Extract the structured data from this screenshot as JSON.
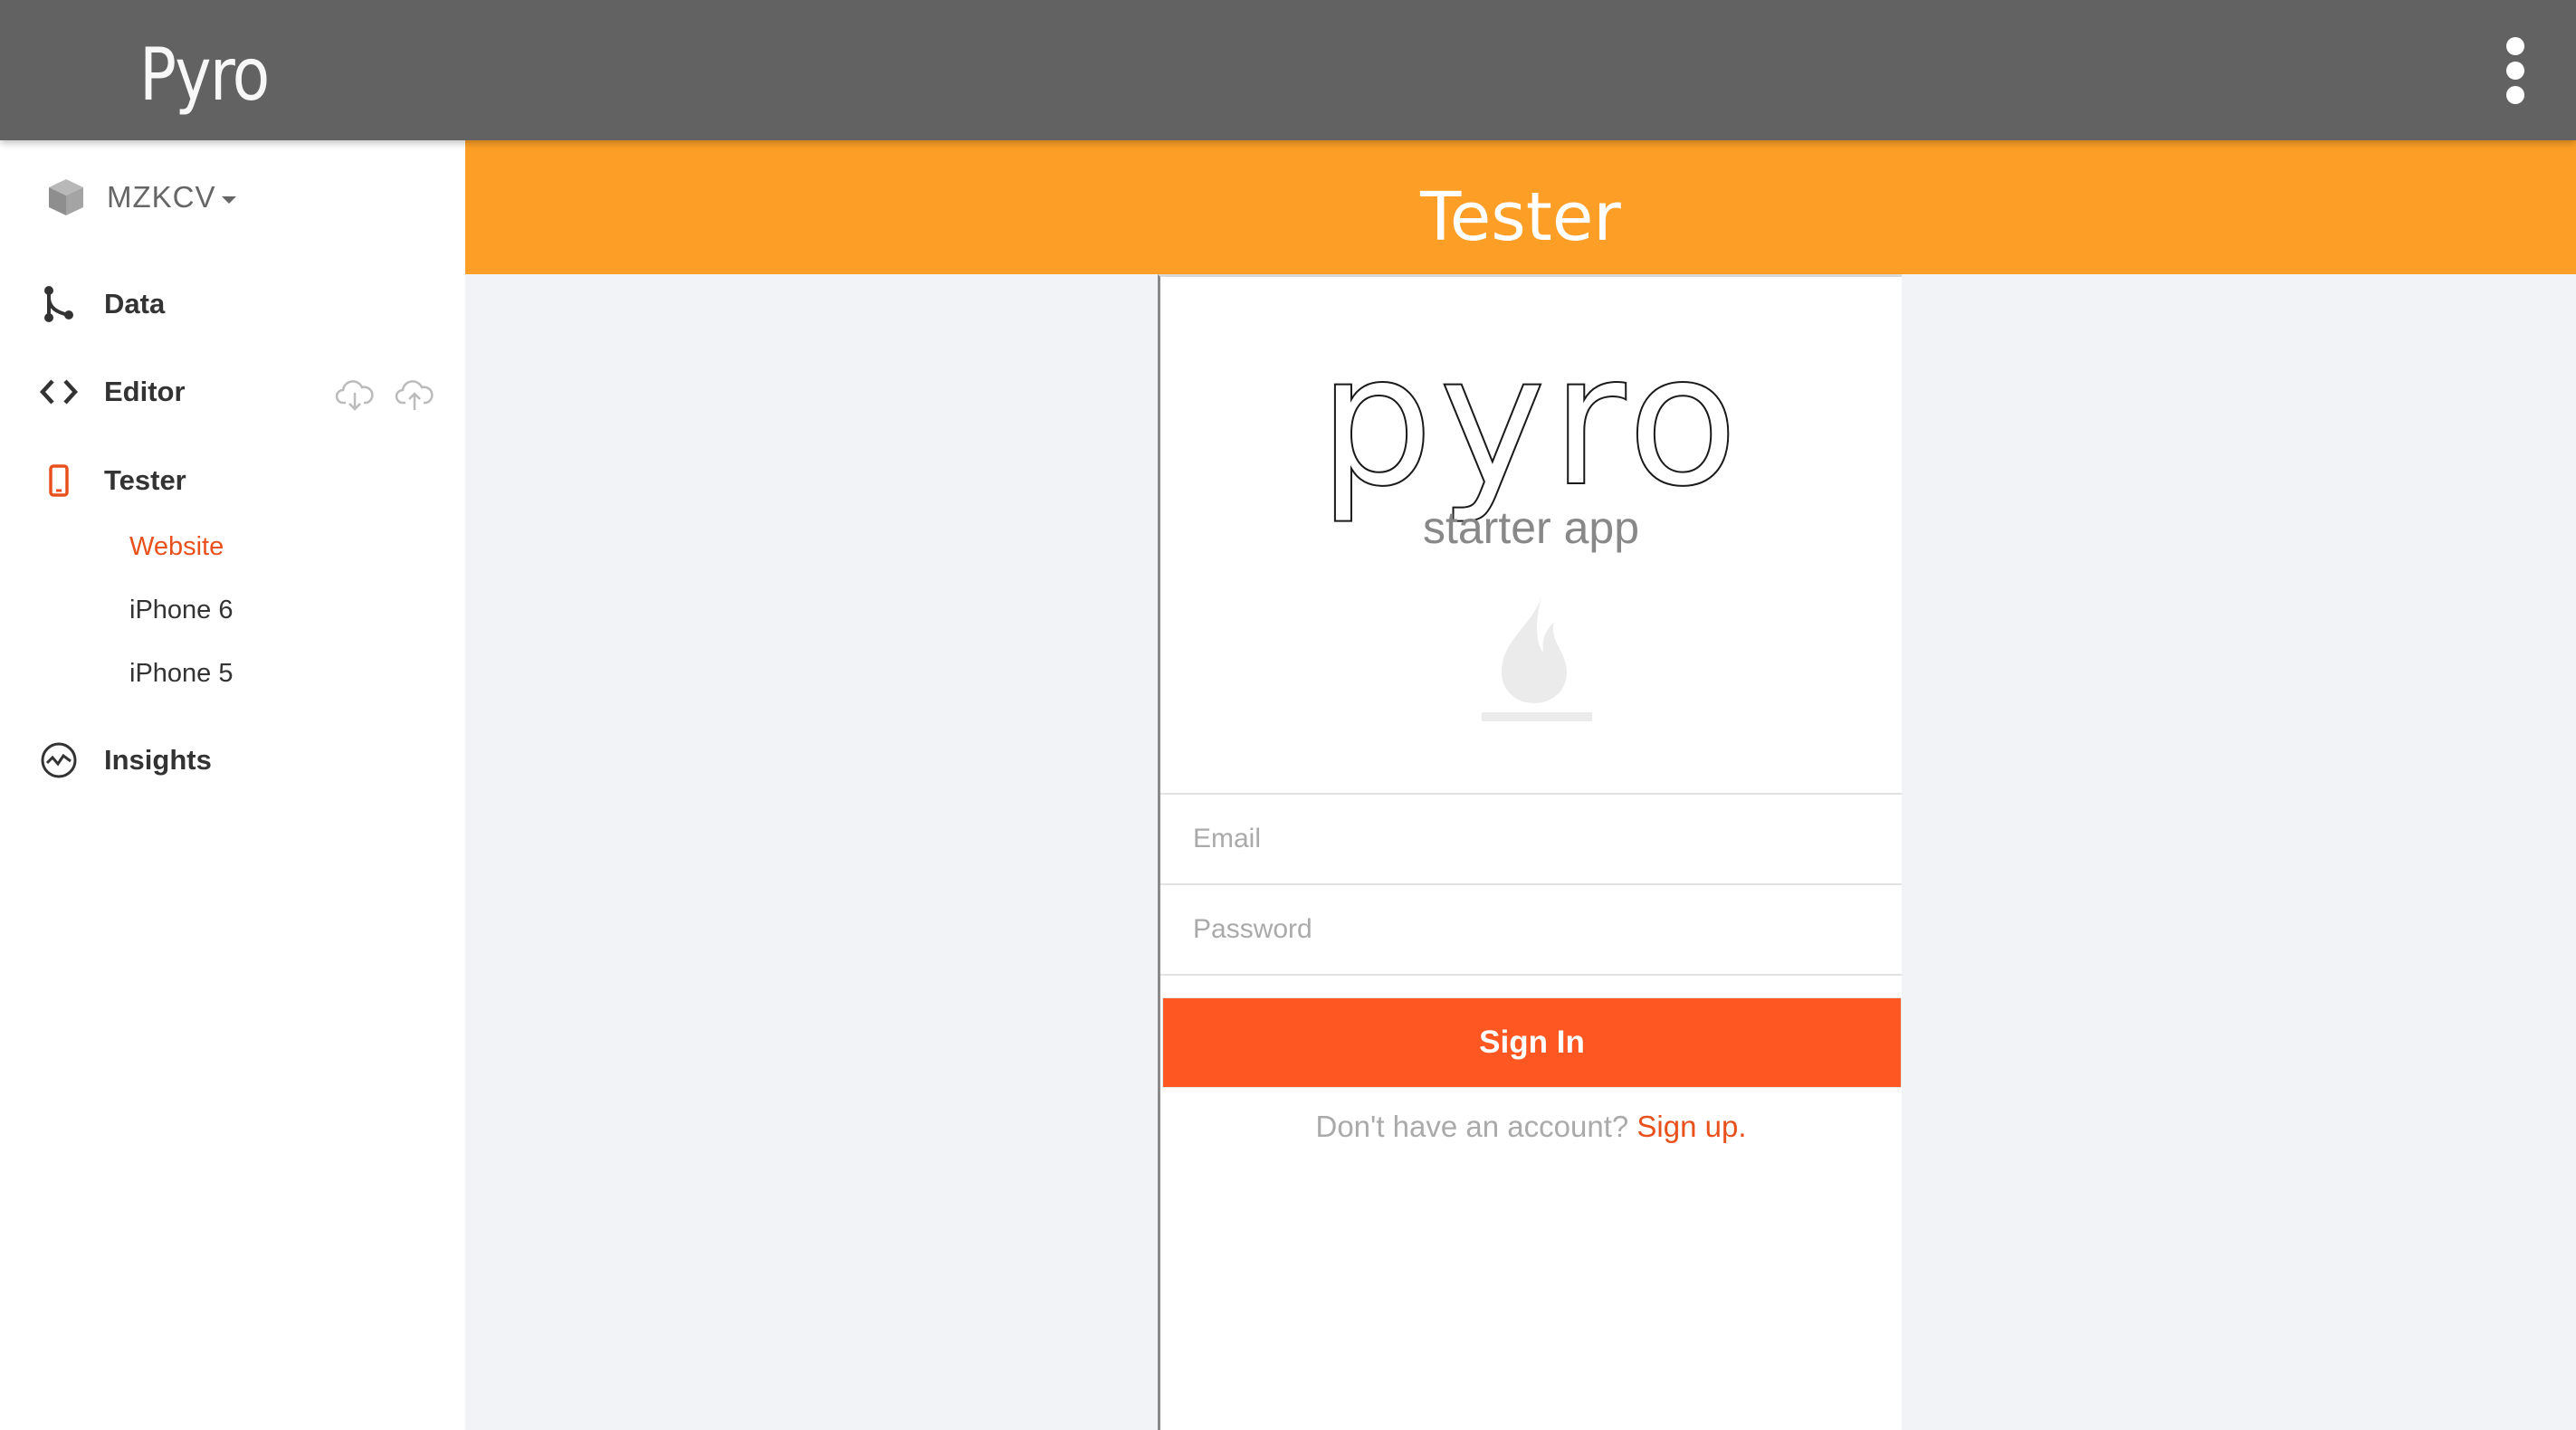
{
  "app": {
    "brand": "Pyro"
  },
  "project": {
    "name": "MZKCV"
  },
  "sidebar": {
    "items": [
      {
        "label": "Data",
        "icon": "branch-icon"
      },
      {
        "label": "Editor",
        "icon": "code-icon"
      },
      {
        "label": "Tester",
        "icon": "mobile-phone-icon"
      },
      {
        "label": "Insights",
        "icon": "pulse-icon"
      }
    ],
    "tester_sub": [
      {
        "label": "Website",
        "active": true
      },
      {
        "label": "iPhone 6",
        "active": false
      },
      {
        "label": "iPhone 5",
        "active": false
      }
    ]
  },
  "main": {
    "title": "Tester"
  },
  "preview": {
    "logo": "pyro",
    "tagline": "starter app",
    "email_placeholder": "Email",
    "password_placeholder": "Password",
    "signin_label": "Sign In",
    "no_account_text": "Don't have an account?",
    "signup_link": "Sign up."
  },
  "colors": {
    "topbar": "#626262",
    "header": "#fd9f26",
    "accent": "#e8511c",
    "button": "#fe5722"
  }
}
